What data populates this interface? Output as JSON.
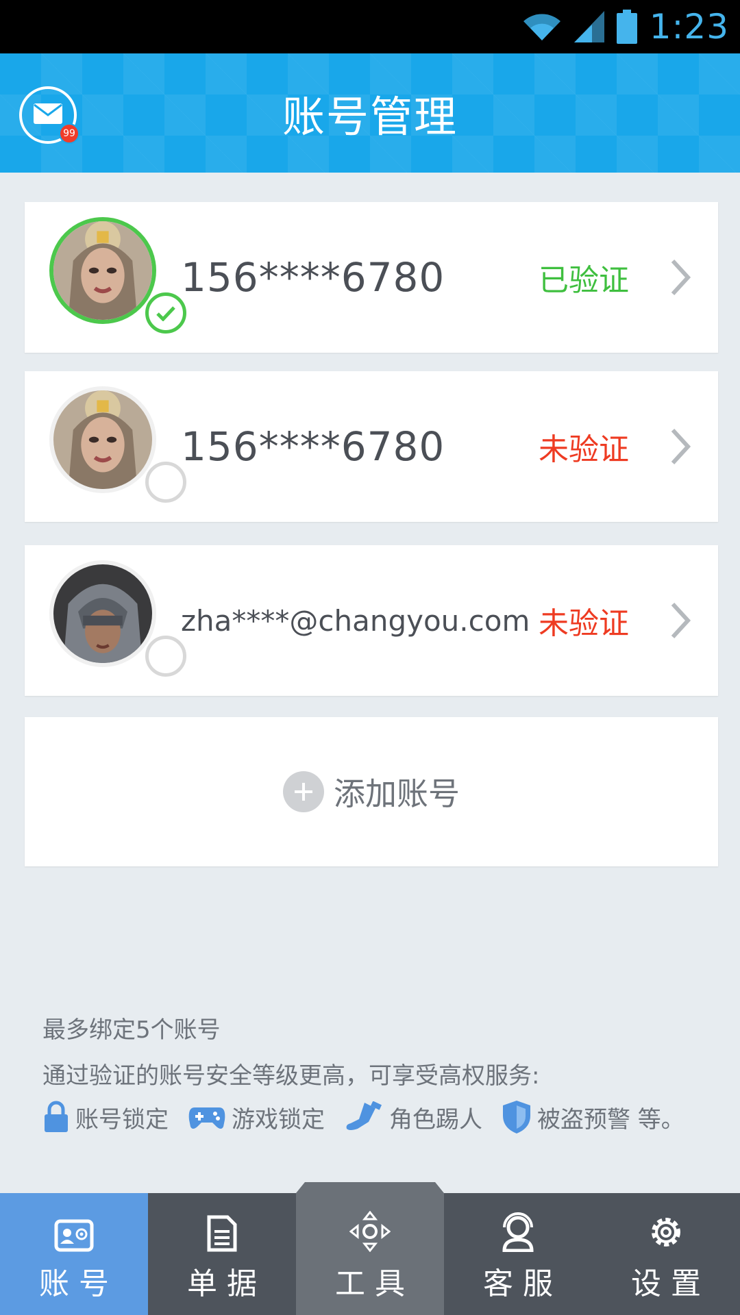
{
  "status_bar": {
    "time": "1:23",
    "icons": [
      "wifi-icon",
      "signal-icon",
      "battery-icon"
    ]
  },
  "header": {
    "title": "账号管理",
    "mail_badge": "99"
  },
  "accounts": [
    {
      "name": "156****6780",
      "status": "已验证",
      "verified": true
    },
    {
      "name": "156****6780",
      "status": "未验证",
      "verified": false
    },
    {
      "name": "zha****@changyou.com",
      "status": "未验证",
      "verified": false
    }
  ],
  "add_account": {
    "label": "添加账号"
  },
  "info": {
    "line1": "最多绑定5个账号",
    "line2": "通过验证的账号安全等级更高，可享受高权服务:",
    "perks": [
      {
        "icon": "lock-icon",
        "label": "账号锁定"
      },
      {
        "icon": "gamepad-icon",
        "label": "游戏锁定"
      },
      {
        "icon": "boot-icon",
        "label": "角色踢人"
      },
      {
        "icon": "shield-icon",
        "label": "被盗预警 等。"
      }
    ]
  },
  "bottom_nav": [
    {
      "icon": "account-card-icon",
      "label": "账号",
      "active": true
    },
    {
      "icon": "document-icon",
      "label": "单据",
      "active": false
    },
    {
      "icon": "tools-icon",
      "label": "工具",
      "active": false
    },
    {
      "icon": "headset-icon",
      "label": "客服",
      "active": false
    },
    {
      "icon": "gear-icon",
      "label": "设置",
      "active": false
    }
  ],
  "colors": {
    "header_blue": "#19a7ea",
    "verified_green": "#3fbf3f",
    "unverified_red": "#ee3b22",
    "nav_active": "#5c9be2",
    "nav_bg": "#4e545c"
  }
}
